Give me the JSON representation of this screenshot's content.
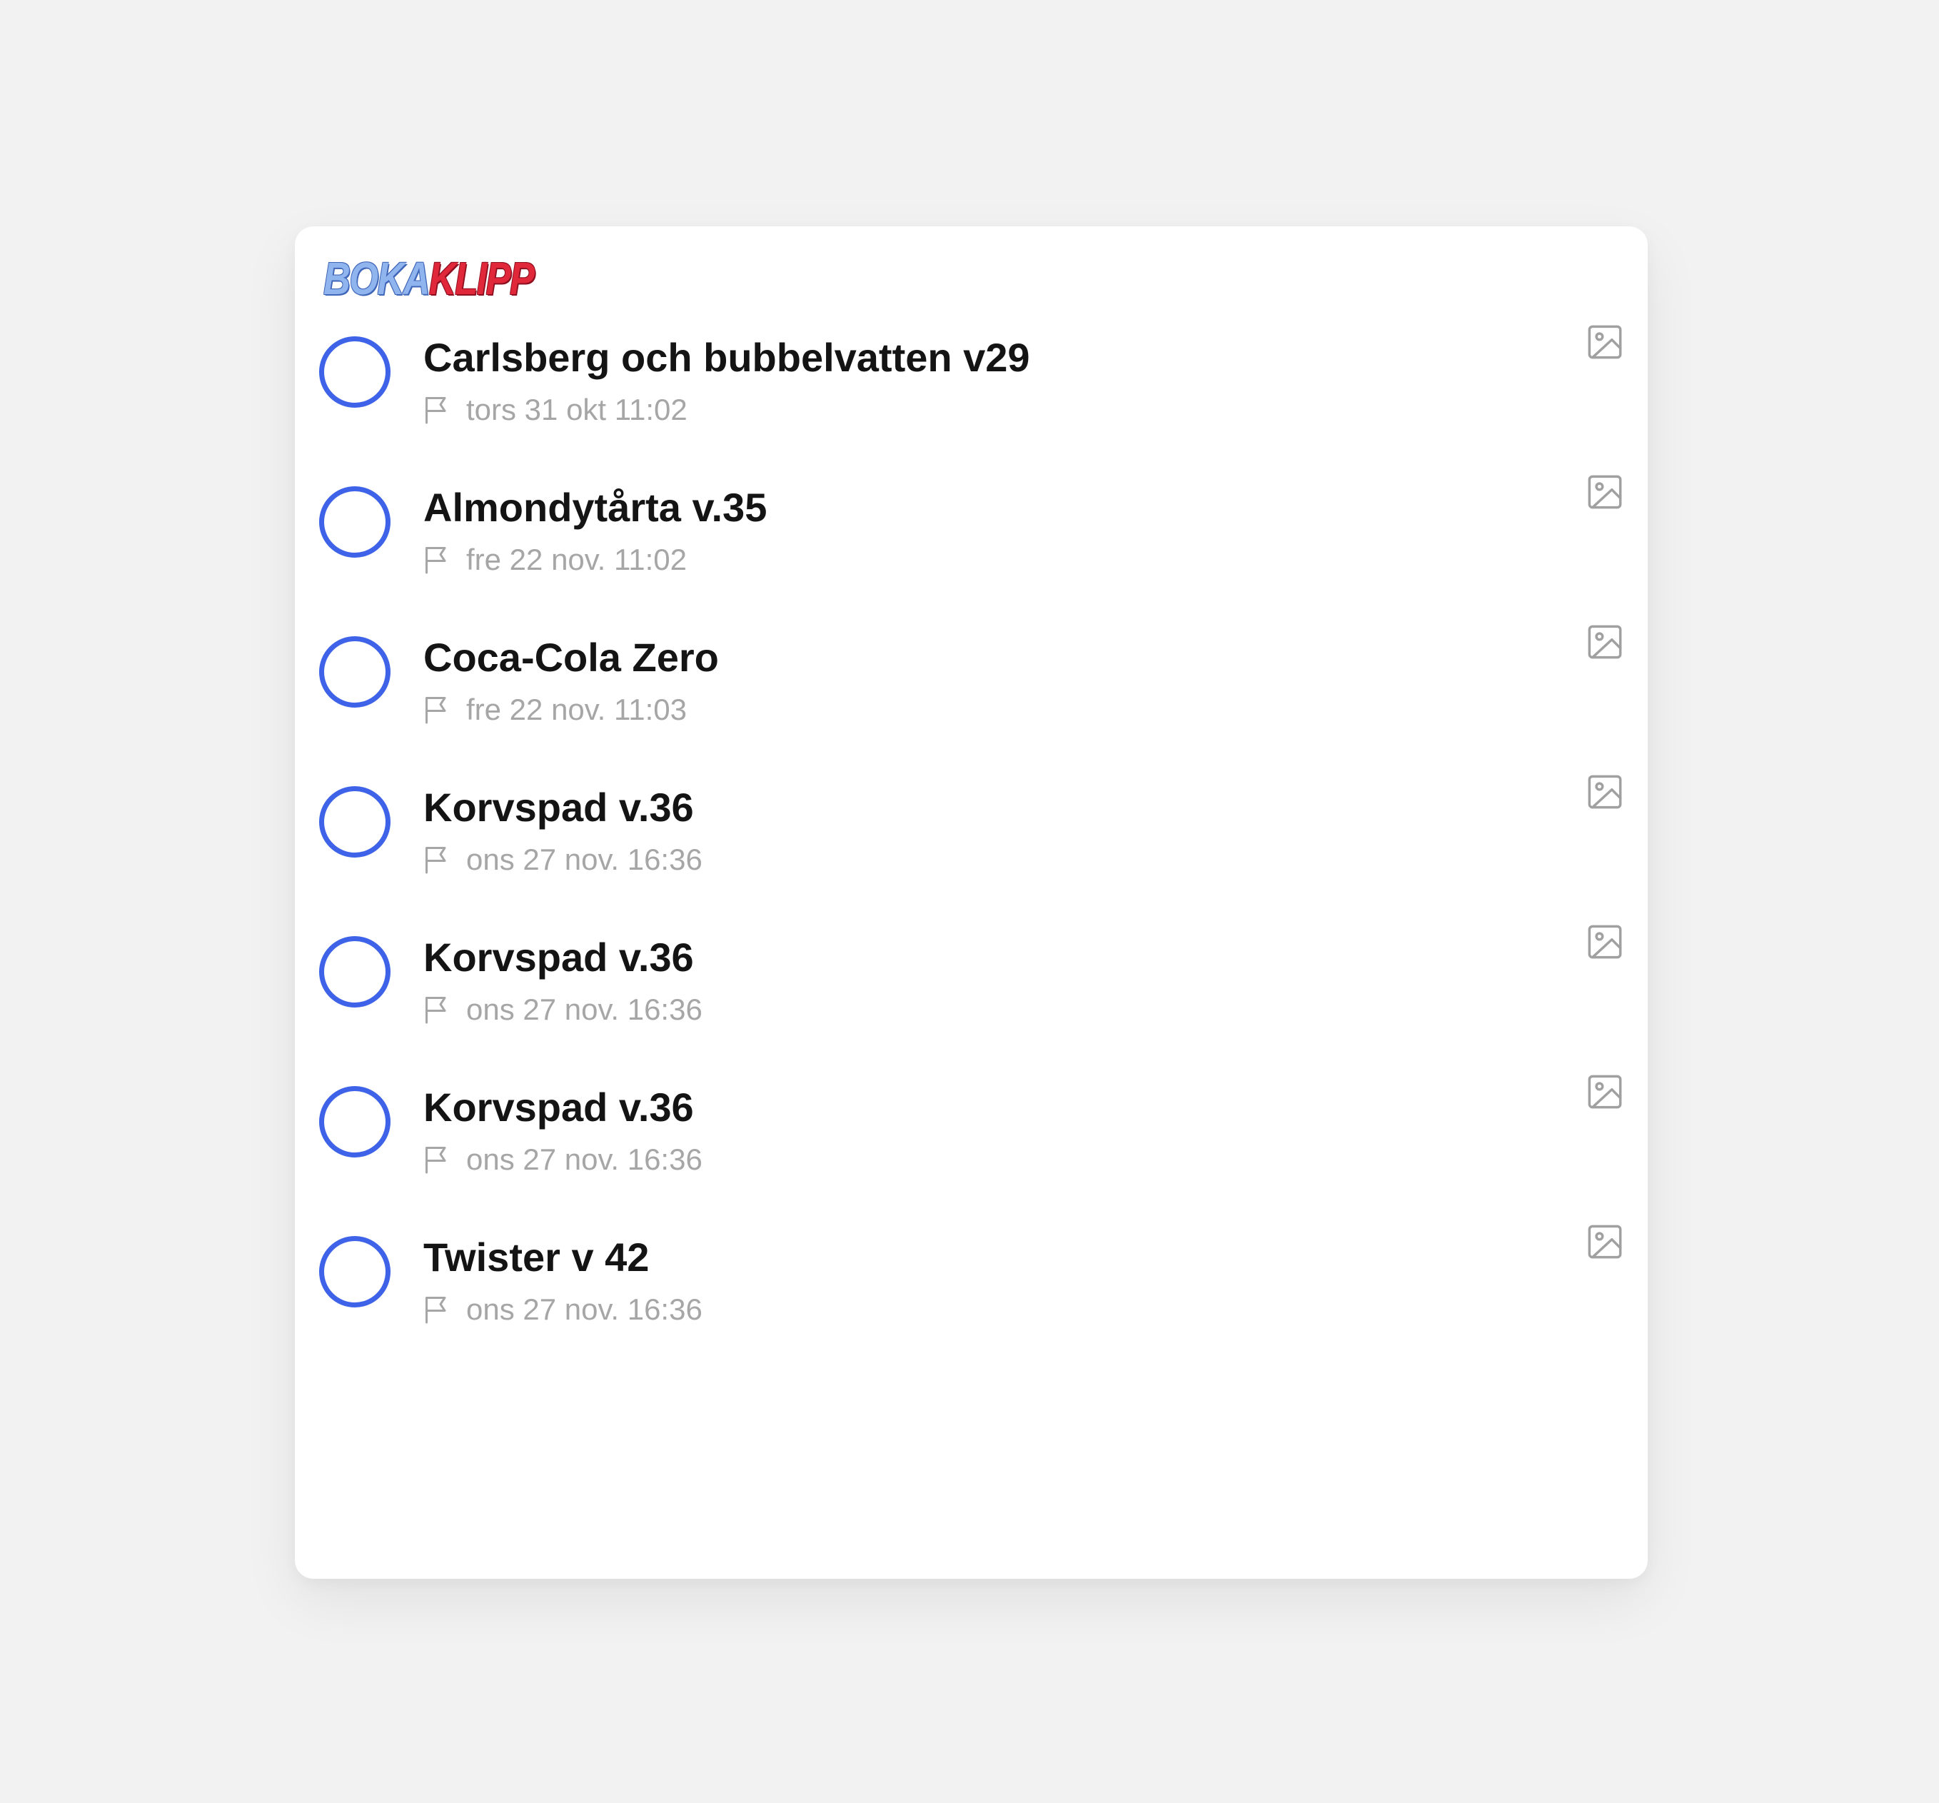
{
  "logo": {
    "part1": "BOKA",
    "part2": "KLIPP"
  },
  "icons": {
    "status": "circle-outline-icon",
    "flag": "flag-icon",
    "image": "image-icon"
  },
  "colors": {
    "accent": "#3e63e8",
    "muted_text": "#a6a6a6",
    "title_text": "#141414",
    "background": "#f2f2f2",
    "card": "#ffffff"
  },
  "tasks": [
    {
      "title": "Carlsberg och bubbelvatten v29",
      "date": "tors 31 okt 11:02"
    },
    {
      "title": "Almondytårta v.35",
      "date": "fre 22 nov. 11:02"
    },
    {
      "title": "Coca-Cola Zero",
      "date": "fre 22 nov. 11:03"
    },
    {
      "title": "Korvspad v.36",
      "date": "ons 27 nov. 16:36"
    },
    {
      "title": "Korvspad v.36",
      "date": "ons 27 nov. 16:36"
    },
    {
      "title": "Korvspad v.36",
      "date": "ons 27 nov. 16:36"
    },
    {
      "title": "Twister v 42",
      "date": "ons 27 nov. 16:36"
    }
  ]
}
